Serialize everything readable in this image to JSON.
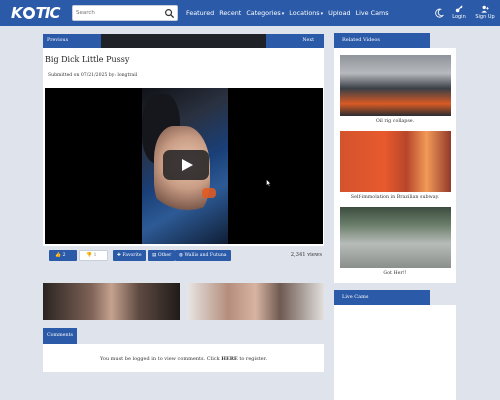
{
  "brand": {
    "logo": "KAOTIC"
  },
  "search": {
    "placeholder": "Search",
    "icon": "search-icon"
  },
  "nav": {
    "items": [
      {
        "label": "Featured",
        "dropdown": false
      },
      {
        "label": "Recent",
        "dropdown": false
      },
      {
        "label": "Categories",
        "dropdown": true
      },
      {
        "label": "Locations",
        "dropdown": true
      },
      {
        "label": "Upload",
        "dropdown": false
      },
      {
        "label": "Live Cams",
        "dropdown": false
      }
    ],
    "login_label": "Login",
    "signup_label": "Sign Up",
    "theme_icon": "moon-icon"
  },
  "pager": {
    "prev_label": "Previous",
    "next_label": "Next"
  },
  "video": {
    "title": "Big Dick Little Pussy",
    "submitted_prefix": "Submitted on 07/21/2025 by: ",
    "submitted_by": "longtrail",
    "up_votes": "2",
    "down_votes": "1",
    "favorite_label": "Favorite",
    "other_label": "Other",
    "tag_label": "Wallis and Futuna",
    "views": "2,341 views"
  },
  "comments": {
    "header": "Comments",
    "message_before": "You must be logged in to view comments. Click ",
    "message_link": "HERE",
    "message_after": " to register."
  },
  "sidebar": {
    "related_header": "Related Videos",
    "related": [
      {
        "caption": "Oil rig collapse."
      },
      {
        "caption": "Self-immolation in Brazilian subway."
      },
      {
        "caption": "Got Her!!"
      }
    ],
    "livecams_header": "Live Cams"
  },
  "colors": {
    "accent": "#2b5aa8",
    "background": "#dfe3ec",
    "panel": "#ffffff"
  }
}
